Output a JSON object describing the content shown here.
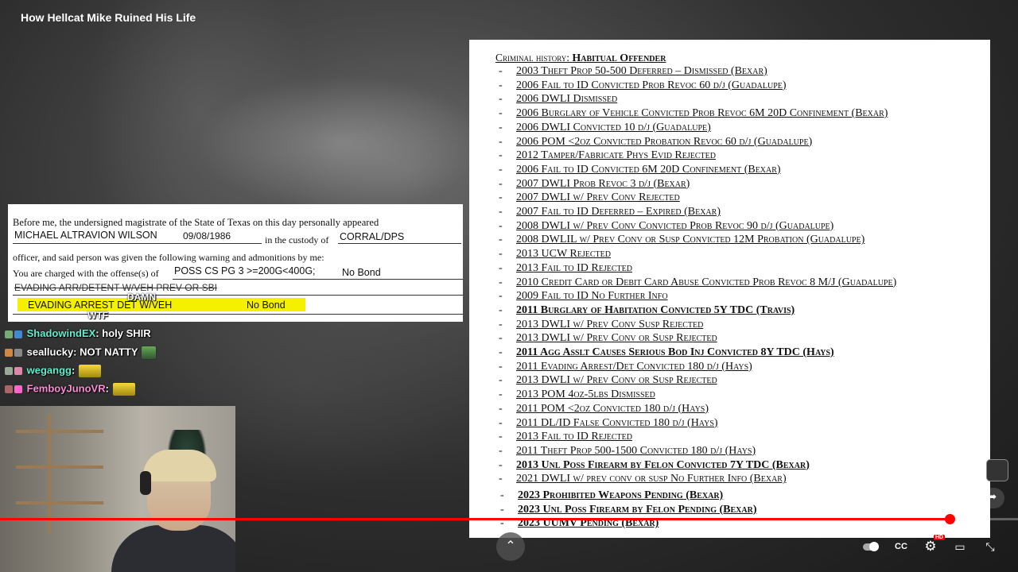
{
  "video": {
    "title": "How Hellcat Mike Ruined His Life"
  },
  "court_doc": {
    "intro": "Before me, the undersigned magistrate of the State of Texas on this day personally appeared",
    "defendant_name": "MICHAEL ALTRAVION WILSON",
    "dob": "09/08/1986",
    "custody_text": "in the custody of",
    "custody": "CORRAL/DPS",
    "warning_text": "officer, and said person was given the following warning and admonitions by me:",
    "charged_text": "You are charged with the offense(s) of",
    "offense_1": "POSS CS PG 3 >=200G<400G;",
    "bond_1": "No Bond",
    "offense_2_struck": "EVADING ARR/DETENT W/VEH PREV OR SBI",
    "offense_3": "EVADING ARREST DET W/VEH",
    "bond_3": "No Bond"
  },
  "chat": [
    {
      "user": "ShadowindEX",
      "message": "holy SHIR",
      "color": "#5ff0d0"
    },
    {
      "user": "seallucky",
      "message": "NOT NATTY",
      "color": "#ffffff"
    },
    {
      "user": "wegangg",
      "message": "",
      "color": "#5ff0d0"
    },
    {
      "user": "FemboyJunoVR",
      "message": "",
      "color": "#ff8ad8"
    }
  ],
  "chat_partial": {
    "line1": "DAMN",
    "line2": "WTF"
  },
  "history": {
    "title_prefix": "Criminal history:",
    "title_main": "Habitual Offender",
    "rows": [
      {
        "text": "2003 Theft Prop 50-500 Deferred – Dismissed (Bexar)",
        "bold": false
      },
      {
        "text": "2006 Fail to ID Convicted Prob Revoc 60 d/j (Guadalupe)",
        "bold": false
      },
      {
        "text": "2006 DWLI Dismissed",
        "bold": false
      },
      {
        "text": "2006 Burglary of Vehicle Convicted Prob Revoc 6M 20D Confinement (Bexar)",
        "bold": false
      },
      {
        "text": "2006 DWLI Convicted 10 d/j (Guadalupe)",
        "bold": false
      },
      {
        "text": "2006 POM <2oz Convicted Probation Revoc 60 d/j (Guadalupe)",
        "bold": false
      },
      {
        "text": "2012 Tamper/Fabricate Phys Evid Rejected",
        "bold": false
      },
      {
        "text": "2006 Fail to ID Convicted 6M 20D Confinement (Bexar)",
        "bold": false
      },
      {
        "text": "2007 DWLI Prob Revoc 3 d/j (Bexar)",
        "bold": false
      },
      {
        "text": "2007 DWLI w/ Prev Conv Rejected",
        "bold": false
      },
      {
        "text": "2007 Fail to ID Deferred – Expired (Bexar)",
        "bold": false
      },
      {
        "text": "2008 DWLI w/ Prev Conv Convicted Prob Revoc 90 d/j (Guadalupe)",
        "bold": false
      },
      {
        "text": "2008 DWLIL w/ Prev Conv or Susp Convicted 12M Probation (Guadalupe)",
        "bold": false
      },
      {
        "text": "2013 UCW Rejected",
        "bold": false
      },
      {
        "text": "2013 Fail to ID Rejected",
        "bold": false
      },
      {
        "text": "2010 Credit Card or Debit Card Abuse Convicted Prob Revoc 8 M/J (Guadalupe)",
        "bold": false
      },
      {
        "text": "2009 Fail to ID No Further Info",
        "bold": false
      },
      {
        "text": "2011 Burglary of Habitation Convicted 5Y TDC (Travis)",
        "bold": true
      },
      {
        "text": "2013 DWLI w/ Prev Conv Susp Rejected",
        "bold": false
      },
      {
        "text": "2013 DWLI w/ Prev Conv or Susp Rejected",
        "bold": false
      },
      {
        "text": "2011 Agg Asslt Causes Serious Bod Inj Convicted 8Y TDC (Hays)",
        "bold": true
      },
      {
        "text": "2011 Evading Arrest/Det Convicted 180 d/j (Hays)",
        "bold": false
      },
      {
        "text": "2013 DWLI w/ Prev Conv or Susp Rejected",
        "bold": false
      },
      {
        "text": "2013 POM 4oz-5lbs Dismissed",
        "bold": false
      },
      {
        "text": "2011 POM <2oz Convicted 180 d/j (Hays)",
        "bold": false
      },
      {
        "text": "2011 DL/ID False Convicted 180 d/j (Hays)",
        "bold": false
      },
      {
        "text": "2013 Fail to ID Rejected",
        "bold": false
      },
      {
        "text": "2011 Theft Prop 500-1500 Convicted 180 d/j (Hays)",
        "bold": false
      },
      {
        "text": "2013 Unl Poss Firearm by Felon Convicted 7Y TDC (Bexar)",
        "bold": true
      },
      {
        "text": "2021 DWLI w/ prev conv or susp No Further Info (Bexar)",
        "bold": false
      },
      {
        "text": "2023 Prohibited Weapons Pending (Bexar)",
        "bold": true
      },
      {
        "text": "2023 Unl Poss Firearm by Felon Pending (Bexar)",
        "bold": true
      },
      {
        "text": "2023 UUMV Pending (Bexar)",
        "bold": true
      }
    ]
  },
  "player": {
    "progress": 0.933,
    "hd_badge": "HD",
    "icons": [
      "like-icon",
      "dislike-icon",
      "comment-icon",
      "share-icon",
      "autoplay-toggle",
      "captions-icon",
      "settings-icon",
      "cast-icon",
      "fullscreen-exit-icon",
      "chevron-up-icon"
    ]
  }
}
